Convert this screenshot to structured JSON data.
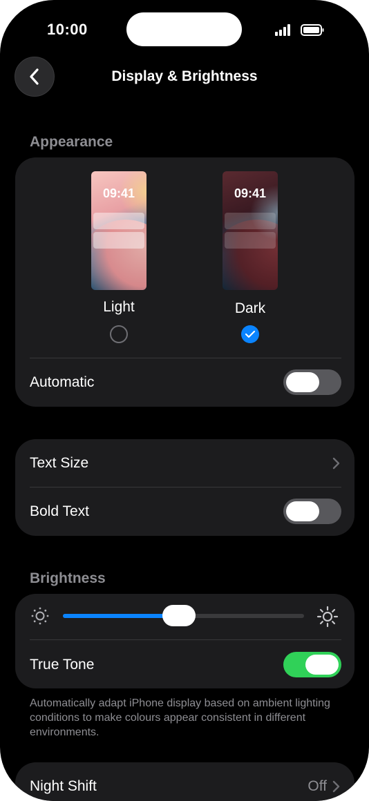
{
  "status_bar": {
    "time": "10:00"
  },
  "nav": {
    "title": "Display & Brightness",
    "back_icon": "chevron-left-icon"
  },
  "appearance": {
    "header": "Appearance",
    "light": {
      "label": "Light",
      "preview_time": "09:41",
      "selected": false
    },
    "dark": {
      "label": "Dark",
      "preview_time": "09:41",
      "selected": true
    },
    "automatic": {
      "label": "Automatic",
      "on": false
    }
  },
  "text": {
    "text_size_label": "Text Size",
    "bold_text": {
      "label": "Bold Text",
      "on": false
    }
  },
  "brightness": {
    "header": "Brightness",
    "level_percent": 48,
    "true_tone": {
      "label": "True Tone",
      "on": true
    },
    "footnote": "Automatically adapt iPhone display based on ambient lighting conditions to make colours appear consistent in different environments."
  },
  "night_shift": {
    "label": "Night Shift",
    "value": "Off"
  },
  "colors": {
    "accent": "#0a84ff",
    "toggle_on": "#30d158",
    "card": "#1c1c1e"
  }
}
